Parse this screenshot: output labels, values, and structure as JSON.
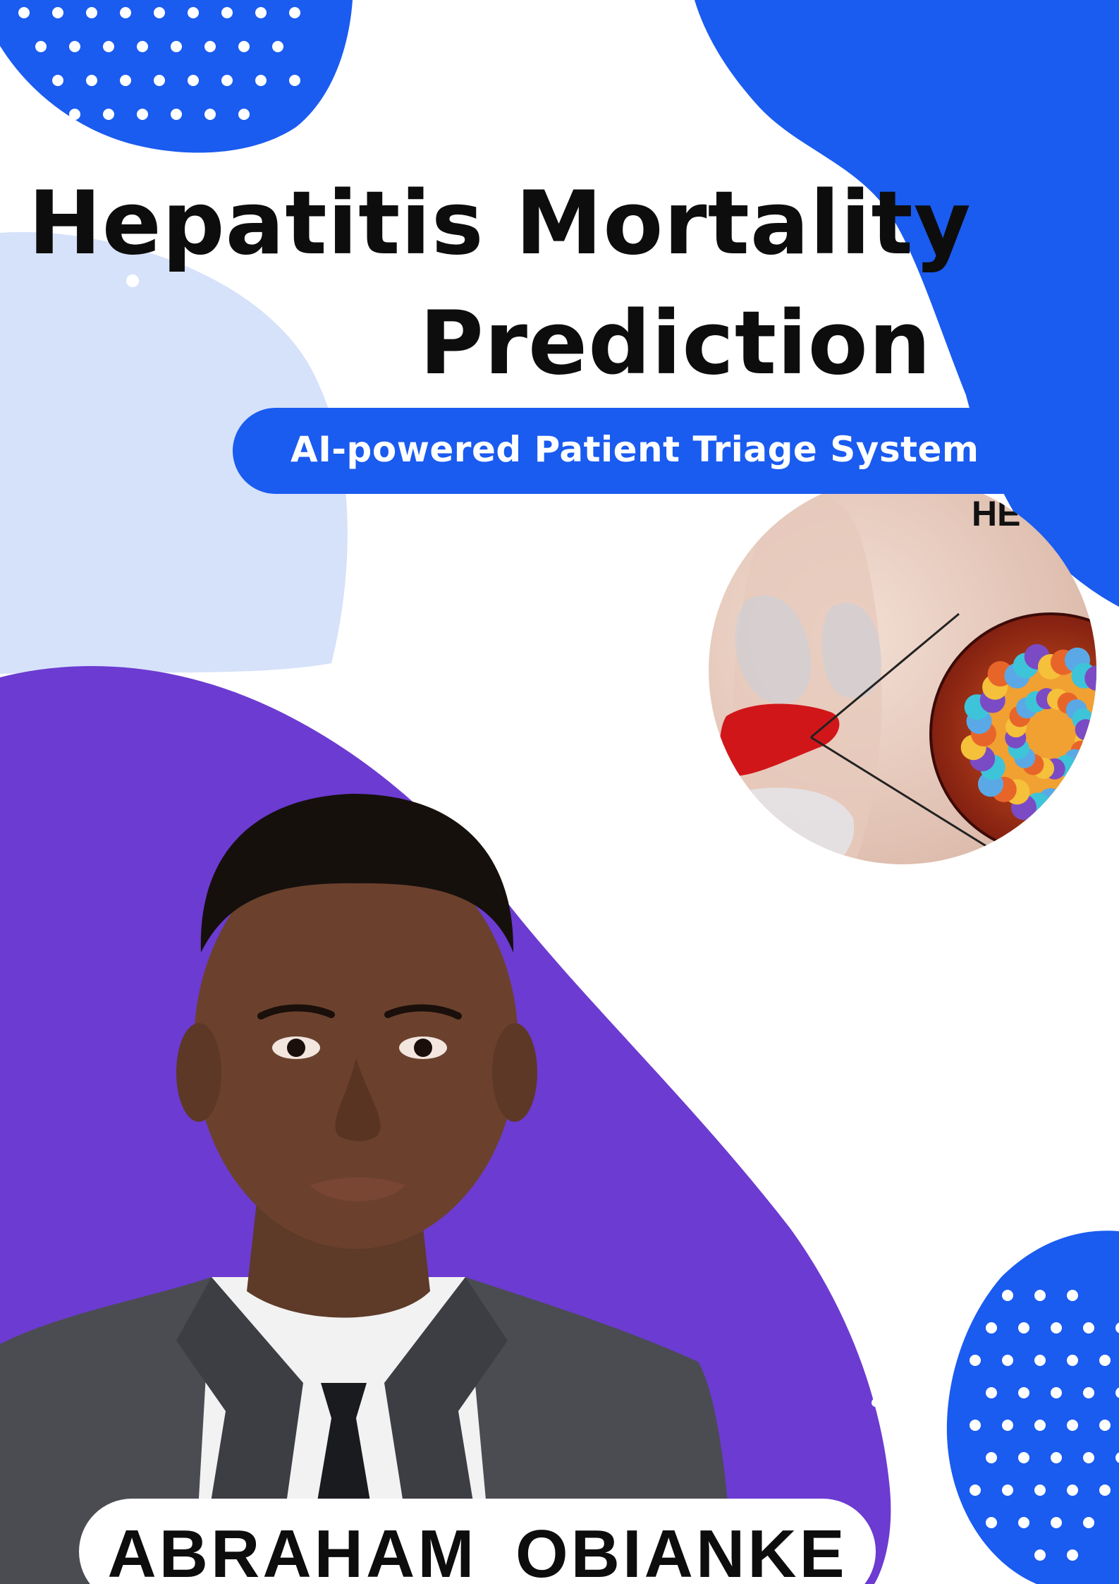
{
  "poster": {
    "title_line1": "Hepatitis Mortality",
    "title_line2": "Prediction",
    "subtitle": "AI-powered Patient Triage System",
    "author_name": "ABRAHAM  OBIANKE"
  },
  "illustration": {
    "label": "HE"
  },
  "colors": {
    "blue": "#1a5bf0",
    "light_blue": "#d6e2fa",
    "purple": "#6c3bd1",
    "title_text": "#0d0d0d",
    "white": "#ffffff"
  },
  "icons": [
    "dot-pattern-blob",
    "liver-virus-illustration",
    "person-portrait"
  ]
}
